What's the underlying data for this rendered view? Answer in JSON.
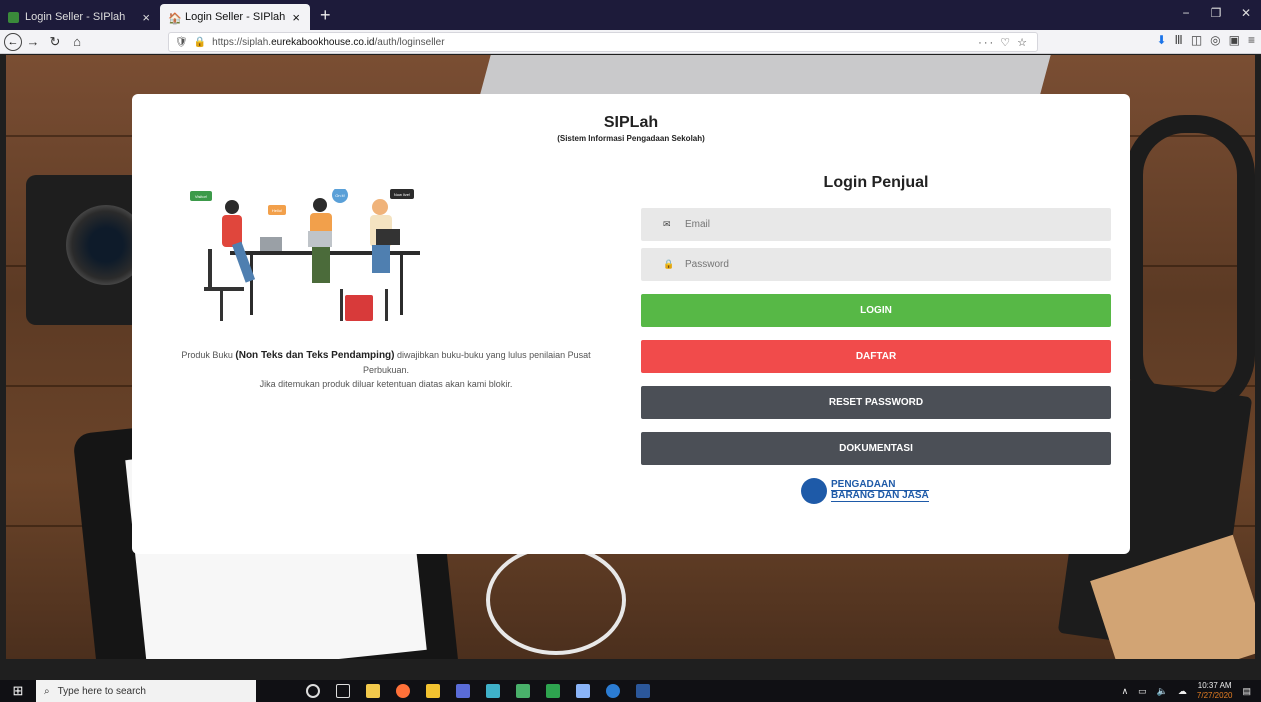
{
  "browser": {
    "tabs": [
      {
        "title": "Login Seller - SIPlah",
        "close": "×"
      },
      {
        "title": "Login Seller - SIPlah",
        "close": "×"
      }
    ],
    "new_tab": "+",
    "window_controls": [
      "−",
      "❐",
      "✕"
    ],
    "url": "https://siplah.eurekabookhouse.co.id/auth/loginseller",
    "url_prefix": "https://siplah.",
    "url_domain": "eurekabookhouse.co.id",
    "url_path": "/auth/loginseller",
    "url_actions": "··· ♡ ☆"
  },
  "brand": {
    "title": "SIPLah",
    "subtitle": "(Sistem Informasi Pengadaan Sekolah)"
  },
  "illustration": {
    "bubbles": [
      "Visitor!",
      "Hello!",
      "On it!",
      "Now live!"
    ]
  },
  "note": {
    "prefix": "Produk Buku ",
    "bold": "(Non Teks dan Teks Pendamping)",
    "suffix": " diwajibkan buku-buku yang lulus penilaian Pusat Perbukuan.",
    "line2": "Jika ditemukan produk diluar ketentuan diatas akan kami blokir."
  },
  "form": {
    "title": "Login Penjual",
    "email_placeholder": "Email",
    "password_placeholder": "Password",
    "login_label": "LOGIN",
    "daftar_label": "DAFTAR",
    "reset_label": "RESET PASSWORD",
    "doc_label": "DOKUMENTASI",
    "logo_line1": "PENGADAAN",
    "logo_line2": "BARANG DAN JASA"
  },
  "taskbar": {
    "search_placeholder": "Type here to search",
    "time": "10:37 AM",
    "date": "7/27/2020"
  },
  "colors": {
    "login": "#57b846",
    "daftar": "#f14b4b",
    "dark_button": "#4b4f56",
    "field_bg": "#e8e8e8"
  }
}
